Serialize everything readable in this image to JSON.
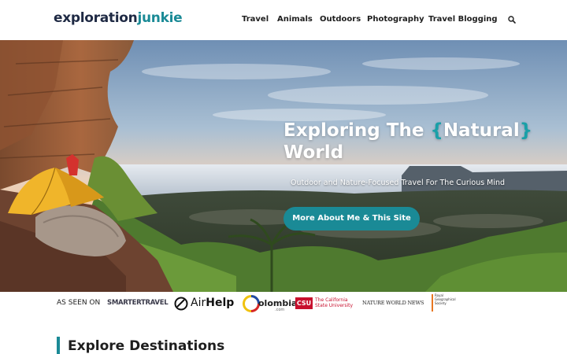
{
  "header": {
    "logo_part1": "exploration",
    "logo_part2": "junkie",
    "nav": [
      "Travel",
      "Animals",
      "Outdoors",
      "Photography",
      "Travel Blogging"
    ],
    "search_icon": "search-icon"
  },
  "hero": {
    "title_line1_pre": "Exploring The ",
    "title_brace_open": "{",
    "title_highlight": "Natural",
    "title_brace_close": "}",
    "title_line2": "World",
    "subtitle": "Outdoor and Nature-Focused Travel For The Curious Mind",
    "cta_label": "More About Me & This Site"
  },
  "as_seen_on": {
    "label": "AS SEEN ON",
    "brands": {
      "smartertravel": "SMARTERTRAVEL",
      "airhelp_a": "Air",
      "airhelp_b": "Help",
      "colombia": "olombia",
      "colombia_sub": ".com",
      "csu_badge": "CSU",
      "csu_line1": "The California",
      "csu_line2": "State University",
      "nwn": "NATURE WORLD NEWS",
      "rgs_line1": "Royal",
      "rgs_line2": "Geographical",
      "rgs_line3": "Society"
    }
  },
  "section": {
    "title": "Explore Destinations"
  },
  "colors": {
    "accent": "#1a8a96",
    "brand_dark": "#1f2a44",
    "text": "#1e1e1e"
  }
}
